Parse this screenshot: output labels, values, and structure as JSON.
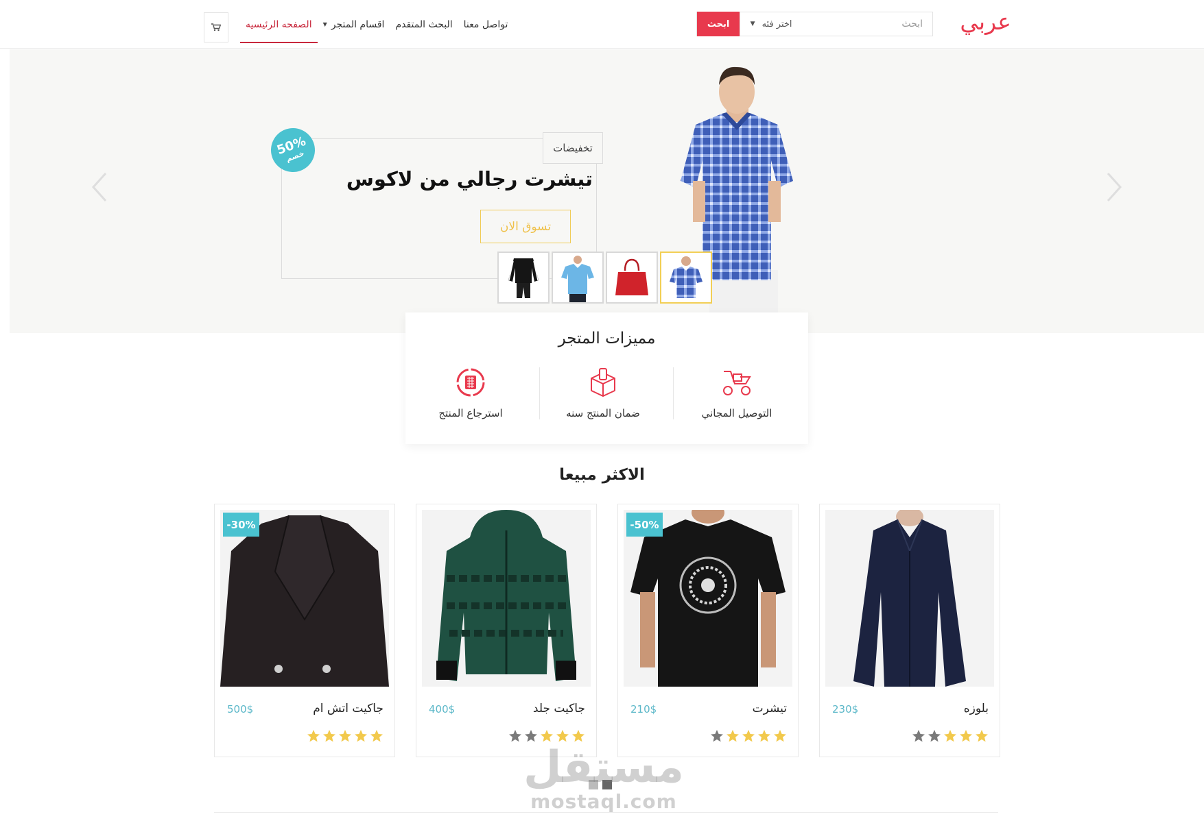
{
  "header": {
    "logo_text": "عربي",
    "search": {
      "placeholder": "ابحث",
      "category_label": "اختر فئه",
      "button_label": "ابحث"
    },
    "nav": [
      {
        "label": "الصفحه الرئيسيه",
        "active": true
      },
      {
        "label": "اقسام المتجر",
        "has_dropdown": true
      },
      {
        "label": "البحث المتقدم"
      },
      {
        "label": "تواصل معنا"
      }
    ],
    "cart_icon": "cart-icon"
  },
  "hero": {
    "tag": "تخفيضات",
    "title": "تيشرت رجالي من لاكوس",
    "cta": "تسوق الان",
    "badge": {
      "percent": "50%",
      "text": "خصم"
    },
    "thumbnails": [
      {
        "name": "plaid-shirt",
        "active": true
      },
      {
        "name": "red-bag"
      },
      {
        "name": "blue-polo"
      },
      {
        "name": "black-tracksuit"
      }
    ]
  },
  "features": {
    "title": "مميزات المتجر",
    "items": [
      {
        "label": "التوصيل المجاني",
        "icon": "delivery-scooter-icon"
      },
      {
        "label": "ضمان المنتج سنه",
        "icon": "box-guarantee-icon"
      },
      {
        "label": "استرجاع المنتج",
        "icon": "return-icon"
      }
    ]
  },
  "best_sellers": {
    "title": "الاكثر مبيعا",
    "products": [
      {
        "name": "بلوزه",
        "price": "230$",
        "rating": 3,
        "badge": ""
      },
      {
        "name": "تيشرت",
        "price": "210$",
        "rating": 4,
        "badge": "-50%"
      },
      {
        "name": "جاكيت جلد",
        "price": "400$",
        "rating": 3,
        "badge": ""
      },
      {
        "name": "جاكيت اتش ام",
        "price": "500$",
        "rating": 5,
        "badge": "-30%"
      }
    ]
  },
  "pager": {
    "count": 2,
    "active_index": 1
  },
  "watermark": {
    "ar": "مستقل",
    "en": "mostaql.com"
  },
  "colors": {
    "accent": "#e8394d",
    "teal": "#4ac2d0",
    "gold": "#f2c94c",
    "nav_active": "#c8283c"
  }
}
